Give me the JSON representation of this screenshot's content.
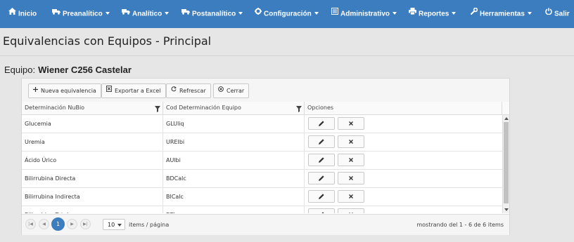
{
  "navbar": {
    "items": [
      {
        "label": "Inicio",
        "icon": "home-icon",
        "dropdown": false
      },
      {
        "label": "Preanalítico",
        "icon": "truck-icon",
        "dropdown": true
      },
      {
        "label": "Analítico",
        "icon": "truck-icon",
        "dropdown": true
      },
      {
        "label": "Postanalítico",
        "icon": "truck-icon",
        "dropdown": true
      },
      {
        "label": "Configuración",
        "icon": "gear-icon",
        "dropdown": true
      },
      {
        "label": "Administrativo",
        "icon": "list-icon",
        "dropdown": true
      },
      {
        "label": "Reportes",
        "icon": "print-icon",
        "dropdown": true
      },
      {
        "label": "Herramientas",
        "icon": "wrench-icon",
        "dropdown": true
      },
      {
        "label": "Salir",
        "icon": "power-icon",
        "dropdown": false
      }
    ]
  },
  "page": {
    "title": "Equivalencias con Equipos - Principal",
    "equipo_label": "Equipo:",
    "equipo_name": "Wiener C256 Castelar"
  },
  "toolbar": {
    "new_label": "Nueva equivalencia",
    "export_label": "Exportar a Excel",
    "refresh_label": "Refrescar",
    "close_label": "Cerrar"
  },
  "grid": {
    "columns": [
      "Determinación NuBio",
      "Cod Determinación Equipo",
      "Opciones"
    ],
    "rows": [
      {
        "determinacion": "Glucemia",
        "codigo": "GLUliq"
      },
      {
        "determinacion": "Uremia",
        "codigo": "UREIbi"
      },
      {
        "determinacion": "Ácido Úrico",
        "codigo": "AUlbi"
      },
      {
        "determinacion": "Bilirrubina Directa",
        "codigo": "BDCalc"
      },
      {
        "determinacion": "Bilirrubina Indirecta",
        "codigo": "BICalc"
      },
      {
        "determinacion": "Bilirrubina Total",
        "codigo": "BTI"
      }
    ]
  },
  "pager": {
    "current_page": "1",
    "page_size": "10",
    "page_size_label": "items / página",
    "info": "mostrando del 1 - 6 de 6 items"
  },
  "colors": {
    "navbar": "#3b7dbf",
    "background": "#e6e6e6",
    "active_page": "#3b7dbf"
  }
}
